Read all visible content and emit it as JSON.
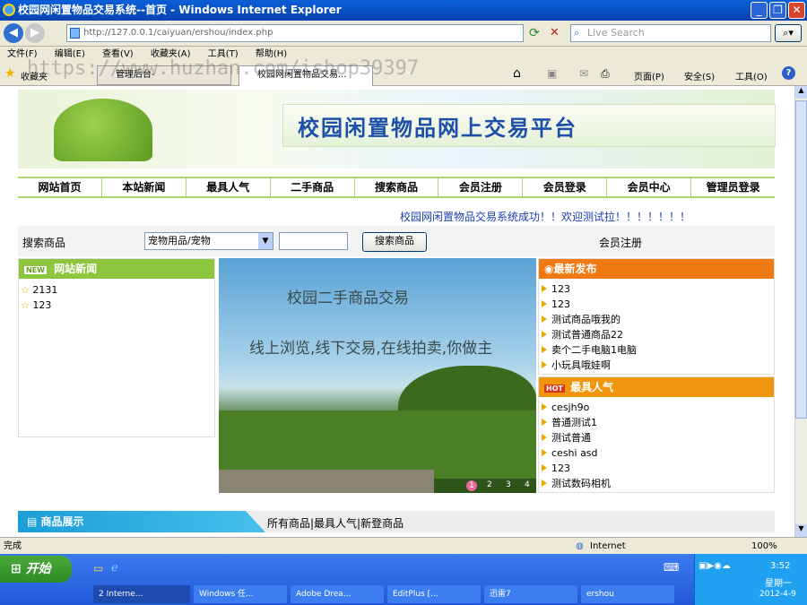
{
  "window": {
    "title": "校园网闲置物品交易系统--首页 - Windows Internet Explorer"
  },
  "address": {
    "url": "http://127.0.0.1/caiyuan/ershou/index.php",
    "search_placeholder": "Live Search"
  },
  "menu": [
    "文件(F)",
    "编辑(E)",
    "查看(V)",
    "收藏夹(A)",
    "工具(T)",
    "帮助(H)"
  ],
  "favbar": {
    "favorites": "收藏夹",
    "tab1": "管理后台-",
    "tab2": "校园网闲置物品交易...",
    "watermark": "https://www.huzhan.com/ishop39397",
    "home_menu": "页面(P)",
    "safety": "安全(S)",
    "tools": "工具(O)"
  },
  "banner": {
    "title": "校园闲置物品网上交易平台"
  },
  "nav": [
    "网站首页",
    "本站新闻",
    "最具人气",
    "二手商品",
    "搜索商品",
    "会员注册",
    "会员登录",
    "会员中心",
    "管理员登录"
  ],
  "marquee": "校园网闲置物品交易系统成功！！欢迎测试拉！！！！！！！",
  "search": {
    "label": "搜索商品",
    "category": "宠物用品/宠物",
    "keyword": "",
    "button": "搜索商品",
    "register": "会员注册"
  },
  "news": {
    "title": "网站新闻",
    "badge": "NEW",
    "items": [
      "2131",
      "123"
    ]
  },
  "slider": {
    "line1": "校园二手商品交易",
    "line2": "线上浏览,线下交易,在线拍卖,你做主",
    "pages": [
      "1",
      "2",
      "3",
      "4"
    ]
  },
  "latest": {
    "title": "最新发布",
    "items": [
      "123",
      "123",
      "测试商品哦我的",
      "测试普通商品22",
      "卖个二手电脑1电脑",
      "小玩具哦娃啊"
    ]
  },
  "popular": {
    "title": "最具人气",
    "badge": "HOT",
    "items": [
      "cesjh9o",
      "普通测试1",
      "测试普通",
      "ceshi asd",
      "123",
      "测试数码相机"
    ]
  },
  "goods": {
    "title": "商品展示",
    "links": "所有商品|最具人气|新登商品"
  },
  "status": {
    "done": "完成",
    "zone": "Internet",
    "zoom": "100%"
  },
  "taskbar": {
    "start": "开始",
    "items": [
      "2 Interne...",
      "Windows 任...",
      "Adobe Drea...",
      "EditPlus [...",
      "迅雷7",
      "ershou"
    ],
    "time": "3:52",
    "day": "星期一",
    "date": "2012-4-9"
  }
}
